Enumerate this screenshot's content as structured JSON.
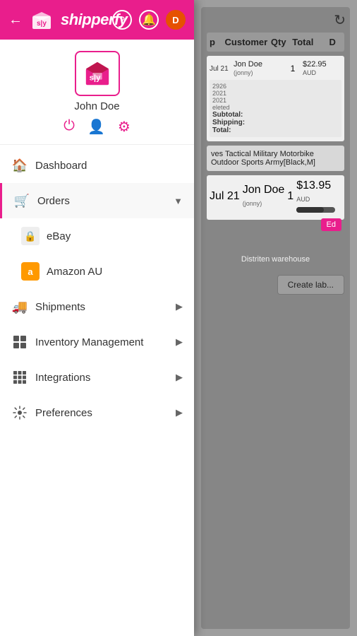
{
  "app": {
    "name": "shipperfy",
    "title": "Shipperfy"
  },
  "header": {
    "back_label": "←",
    "help_icon": "?",
    "bell_icon": "🔔",
    "avatar_label": "D"
  },
  "profile": {
    "name": "John Doe",
    "power_icon": "⏻",
    "user_icon": "👤",
    "settings_icon": "⚙"
  },
  "nav": {
    "items": [
      {
        "id": "dashboard",
        "label": "Dashboard",
        "icon": "🏠",
        "has_arrow": false
      },
      {
        "id": "orders",
        "label": "Orders",
        "icon": "🛒",
        "has_arrow": true
      },
      {
        "id": "ebay",
        "label": "eBay",
        "icon": "🔒",
        "is_sub": true
      },
      {
        "id": "amazon-au",
        "label": "Amazon AU",
        "icon": "A",
        "is_sub": true
      },
      {
        "id": "shipments",
        "label": "Shipments",
        "icon": "🚚",
        "has_arrow": true
      },
      {
        "id": "inventory",
        "label": "Inventory Management",
        "icon": "📊",
        "has_arrow": true
      },
      {
        "id": "integrations",
        "label": "Integrations",
        "icon": "⊞",
        "has_arrow": true
      },
      {
        "id": "preferences",
        "label": "Preferences",
        "icon": "⚙",
        "has_arrow": true
      }
    ]
  },
  "main": {
    "refresh_icon": "↻",
    "table_headers": [
      "",
      "Customer",
      "Qty",
      "Total",
      "D"
    ],
    "order1": {
      "date": "Jul 21",
      "customer_name": "Jon Doe",
      "customer_id": "(jonny)",
      "qty": "1",
      "total": "$22.95",
      "currency": "AUD",
      "subtotal_label": "Subtotal:",
      "shipping_label": "Shipping:",
      "total_label": "Total:",
      "order_id": "2926",
      "year1": "2021",
      "year2": "2021",
      "status": "eleted"
    },
    "product_desc": "ves Tactical Military Motorbike Outdoor Sports Army[Black,M]",
    "order2": {
      "date": "Jul 21",
      "customer_name": "Jon Doe",
      "customer_id": "(jonny)",
      "qty": "1",
      "total": "$13.95",
      "currency": "AUD"
    },
    "edit_label": "Ed",
    "warehouse_label": "Distriten warehouse",
    "create_label_btn": "Create lab..."
  }
}
